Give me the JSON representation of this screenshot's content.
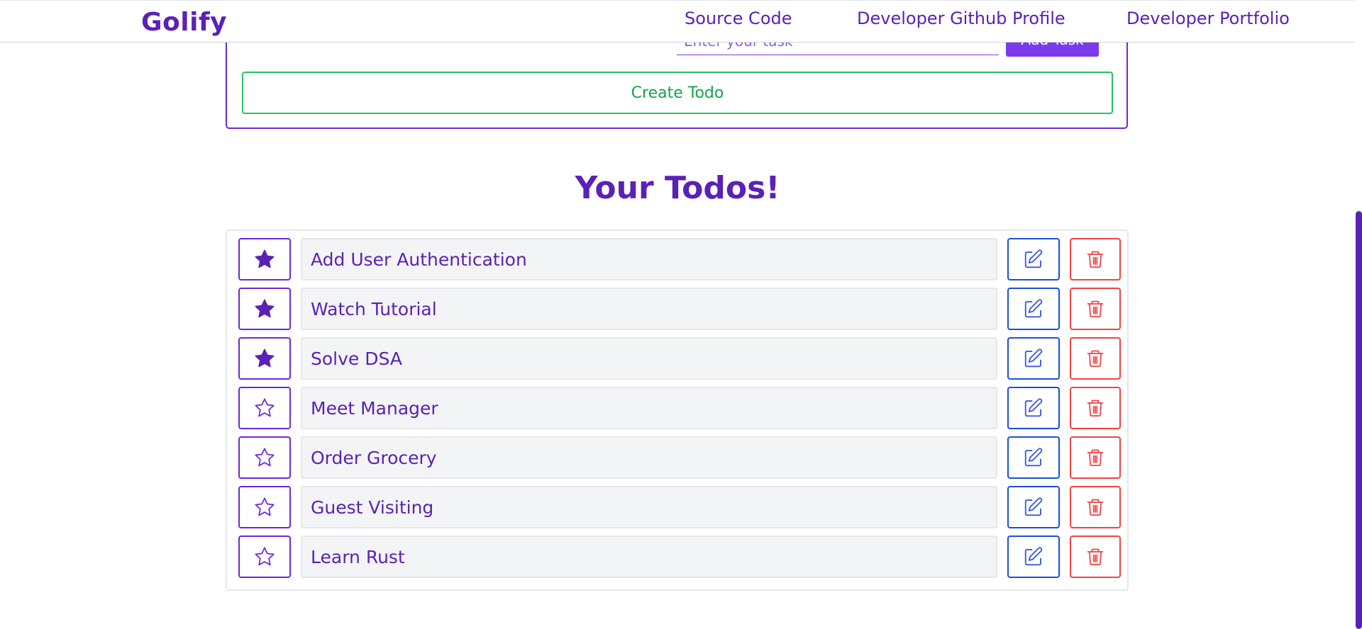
{
  "navbar": {
    "brand": "Golify",
    "links": [
      "Source Code",
      "Developer Github Profile",
      "Developer Portfolio"
    ]
  },
  "form": {
    "task_placeholder": "Enter your task",
    "add_task_label": "Add Task",
    "create_todo_label": "Create Todo"
  },
  "todos": {
    "title": "Your Todos!",
    "items": [
      {
        "text": "Add User Authentication",
        "starred": true
      },
      {
        "text": "Watch Tutorial",
        "starred": true
      },
      {
        "text": "Solve DSA",
        "starred": true
      },
      {
        "text": "Meet Manager",
        "starred": false
      },
      {
        "text": "Order Grocery",
        "starred": false
      },
      {
        "text": "Guest Visiting",
        "starred": false
      },
      {
        "text": "Learn Rust",
        "starred": false
      }
    ],
    "icons": {
      "star": "star-icon",
      "edit": "edit-icon",
      "delete": "trash-icon"
    }
  },
  "colors": {
    "primary": "#5b21b6",
    "accent": "#7c3aed",
    "success": "#22c55e",
    "edit": "#1d4ed8",
    "danger": "#ef4444",
    "row_bg": "#f3f4f6"
  }
}
